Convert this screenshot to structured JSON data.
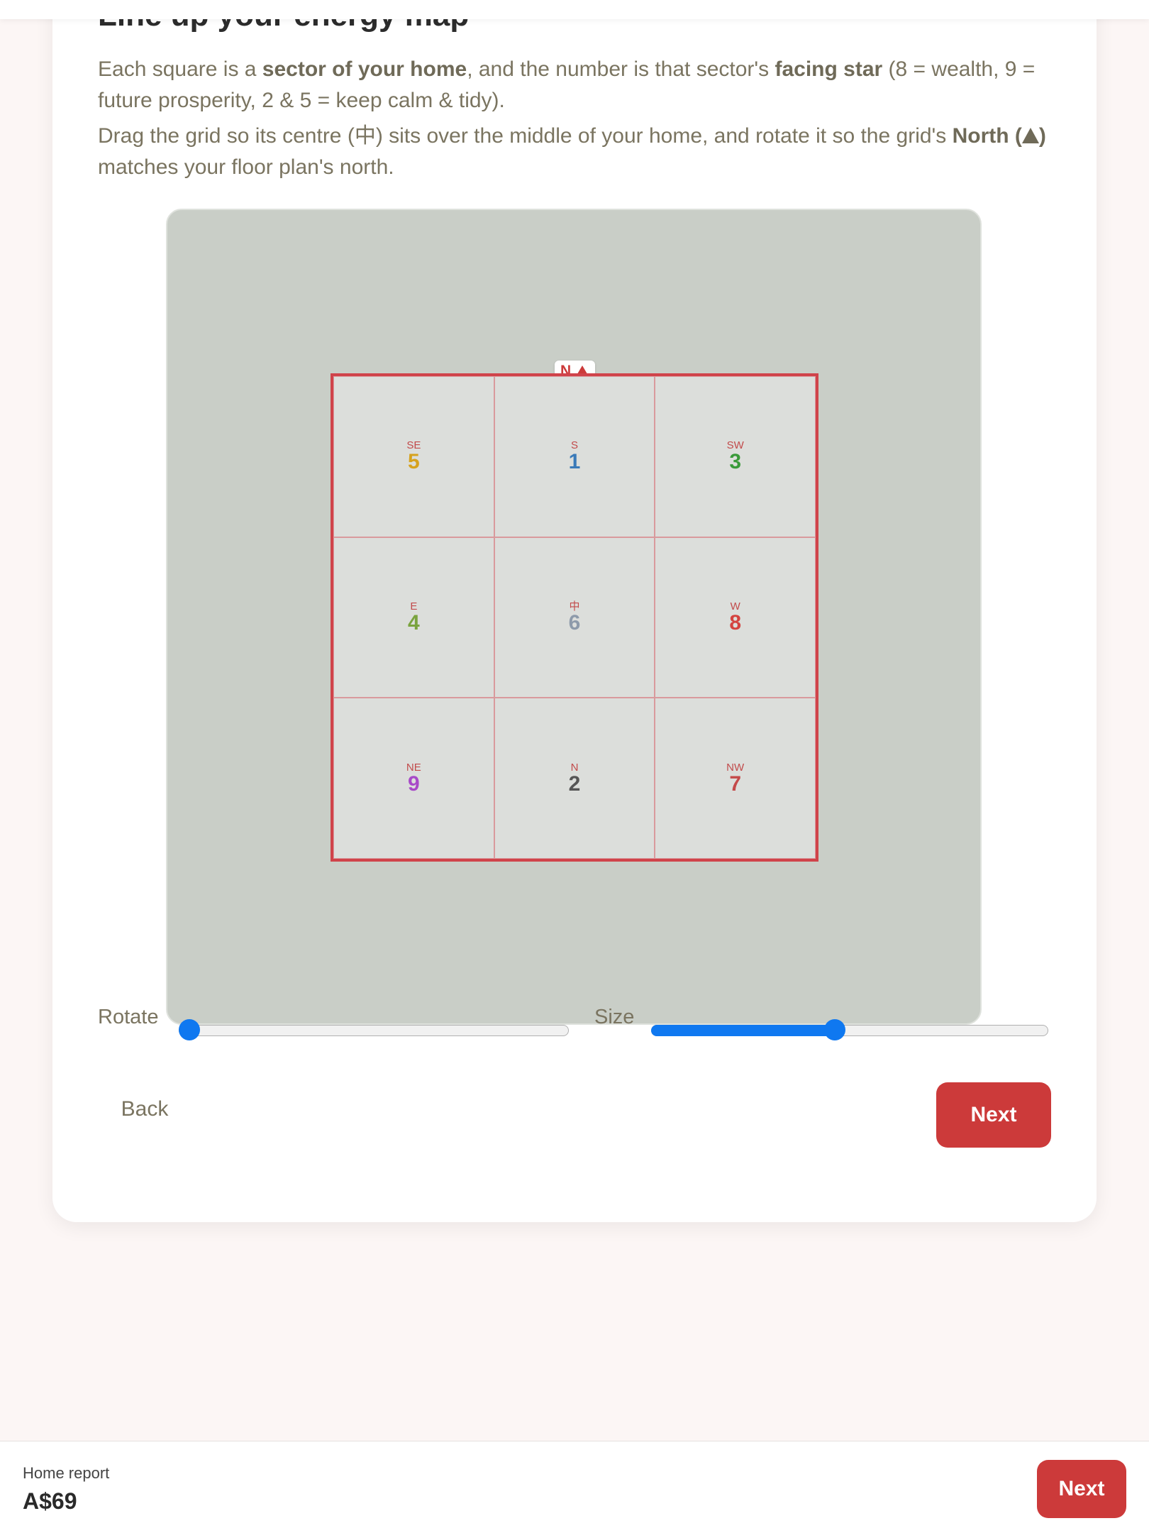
{
  "header": {
    "title": "Line up your energy map"
  },
  "intro": {
    "p1_a": "Each square is a ",
    "p1_b": "sector of your home",
    "p1_c": ", and the number is that sector's ",
    "p1_d": "facing star",
    "p1_e": " (8 = wealth, 9 = future prosperity, 2 & 5 = keep calm & tidy).",
    "p2_a": "Drag the grid so its centre (中) sits over the middle of your home, and rotate it so the grid's ",
    "p2_b": "North (",
    "p2_c": ")",
    "p2_d": " matches your floor plan's north."
  },
  "grid": {
    "north_label": "N",
    "cells": [
      {
        "dir": "SE",
        "num": "5",
        "color": "#d6a21e"
      },
      {
        "dir": "S",
        "num": "1",
        "color": "#3a7ab8"
      },
      {
        "dir": "SW",
        "num": "3",
        "color": "#3a9a3a"
      },
      {
        "dir": "E",
        "num": "4",
        "color": "#7aa33e"
      },
      {
        "dir": "中",
        "num": "6",
        "color": "#8d9aaa"
      },
      {
        "dir": "W",
        "num": "8",
        "color": "#d4433f"
      },
      {
        "dir": "NE",
        "num": "9",
        "color": "#a84ac8"
      },
      {
        "dir": "N",
        "num": "2",
        "color": "#555555"
      },
      {
        "dir": "NW",
        "num": "7",
        "color": "#c44a4a"
      }
    ]
  },
  "controls": {
    "rotate_label": "Rotate",
    "size_label": "Size",
    "rotate_value": 0,
    "size_value": 0.46
  },
  "nav": {
    "back_label": "Back",
    "next_label": "Next"
  },
  "footer": {
    "label": "Home report",
    "price": "A$69",
    "next_label": "Next"
  },
  "colors": {
    "accent": "#cc3a3a",
    "slider": "#0f78f0"
  }
}
